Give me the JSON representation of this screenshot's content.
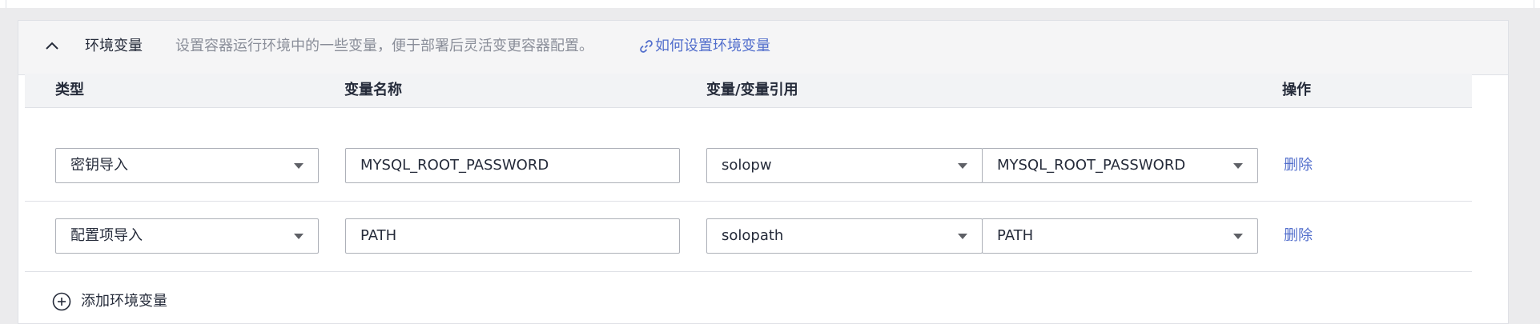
{
  "section": {
    "title": "环境变量",
    "description": "设置容器运行环境中的一些变量，便于部署后灵活变更容器配置。",
    "help_link": "如何设置环境变量"
  },
  "table": {
    "headers": {
      "type": "类型",
      "name": "变量名称",
      "value": "变量/变量引用",
      "action": "操作"
    },
    "rows": [
      {
        "type": "密钥导入",
        "name": "MYSQL_ROOT_PASSWORD",
        "ref_source": "solopw",
        "ref_key": "MYSQL_ROOT_PASSWORD",
        "action": "删除"
      },
      {
        "type": "配置项导入",
        "name": "PATH",
        "ref_source": "solopath",
        "ref_key": "PATH",
        "action": "删除"
      }
    ]
  },
  "add_button": {
    "label": "添加环境变量"
  },
  "colors": {
    "link": "#526ecc",
    "header_bg": "#f5f5f6",
    "table_header_bg": "#f2f3f5",
    "border": "#dfe1e6"
  }
}
